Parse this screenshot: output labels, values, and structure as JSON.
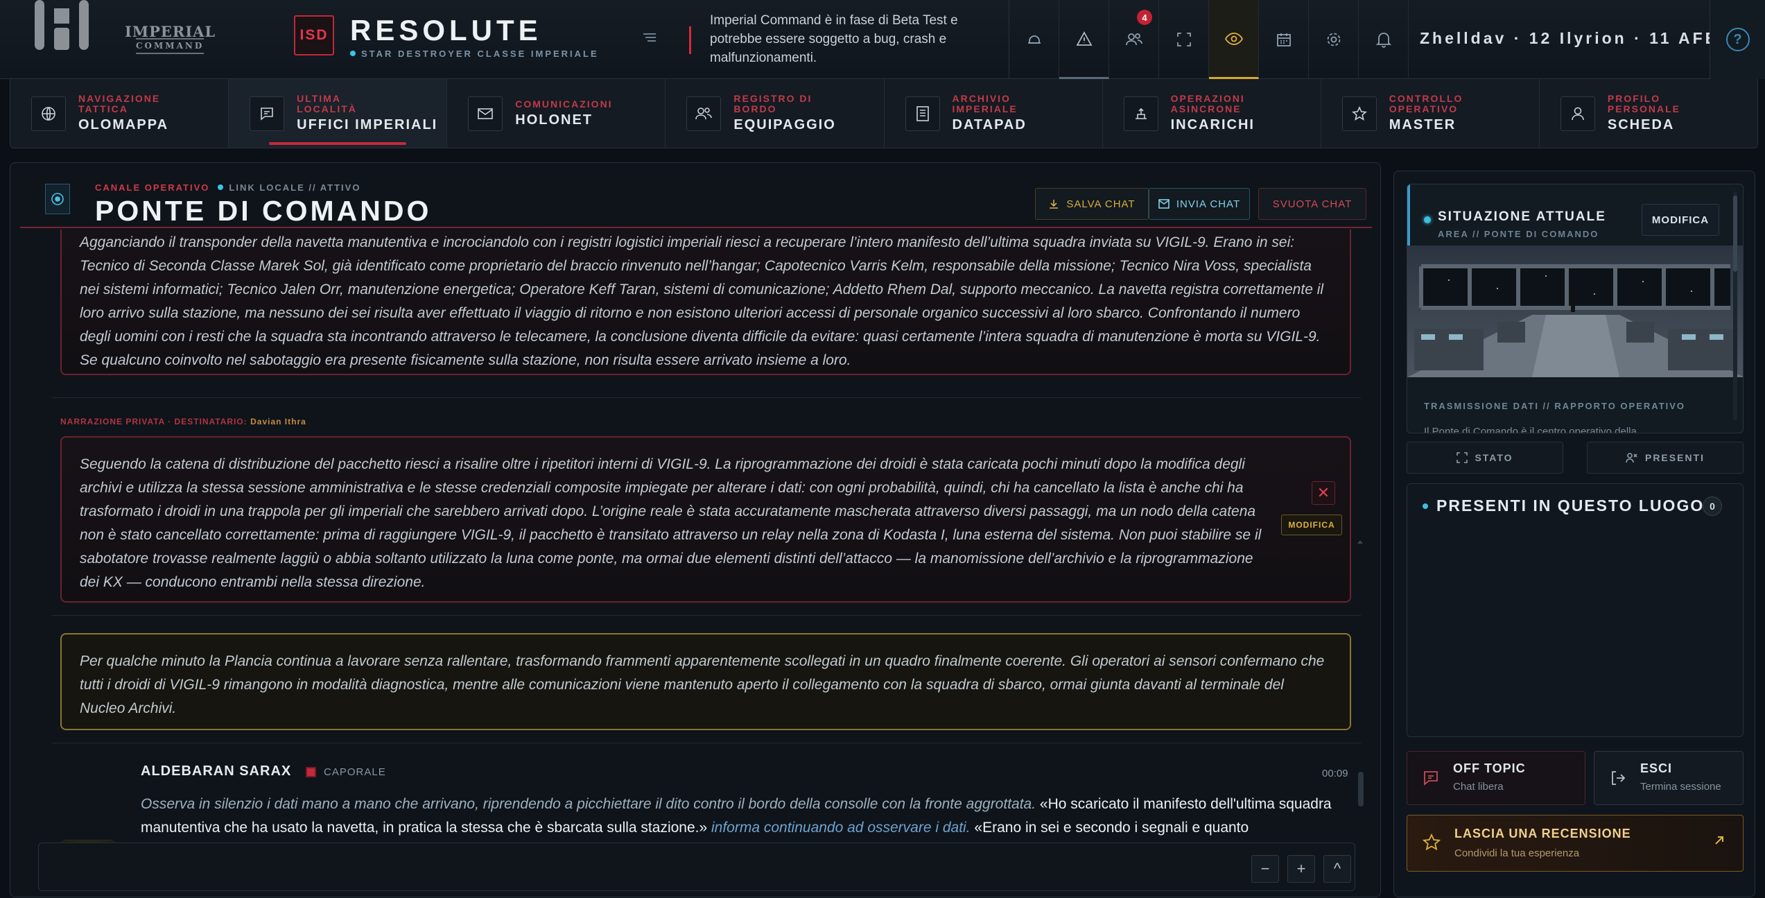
{
  "brand": {
    "emblem_line1": "IMPERIAL",
    "emblem_line2": "COMMAND"
  },
  "ship": {
    "badge": "ISD",
    "name": "RESOLUTE",
    "class": "STAR DESTROYER CLASSE IMPERIALE"
  },
  "beta_notice": "Imperial Command è in fase di Beta Test e potrebbe essere soggetto a bug, crash e malfunzionamenti.",
  "toolbar": {
    "notification_badge": "4",
    "date": "Zhelldav · 12 Ilyrion · 11 AFE",
    "help": "?"
  },
  "nav": [
    {
      "category": "NAVIGAZIONE TATTICA",
      "label": "OLOMAPPA",
      "icon": "globe-icon"
    },
    {
      "category": "ULTIMA LOCALITÀ",
      "label": "UFFICI IMPERIALI",
      "icon": "chat-icon",
      "active": true
    },
    {
      "category": "COMUNICAZIONI",
      "label": "HOLONET",
      "icon": "mail-icon"
    },
    {
      "category": "REGISTRO DI BORDO",
      "label": "EQUIPAGGIO",
      "icon": "users-icon"
    },
    {
      "category": "ARCHIVIO IMPERIALE",
      "label": "DATAPAD",
      "icon": "document-icon"
    },
    {
      "category": "OPERAZIONI ASINCRONE",
      "label": "INCARICHI",
      "icon": "tasks-icon"
    },
    {
      "category": "CONTROLLO OPERATIVO",
      "label": "MASTER",
      "icon": "star-icon"
    },
    {
      "category": "PROFILO PERSONALE",
      "label": "SCHEDA",
      "icon": "user-icon"
    }
  ],
  "channel": {
    "type": "CANALE OPERATIVO",
    "status": "LINK LOCALE // ATTIVO",
    "title": "PONTE DI COMANDO",
    "save_label": "SALVA CHAT",
    "send_label": "INVIA CHAT",
    "clear_label": "SVUOTA CHAT"
  },
  "messages": {
    "narr1": "Agganciando il transponder della navetta manutentiva e incrociandolo con i registri logistici imperiali riesci a recuperare l’intero manifesto dell’ultima squadra inviata su VIGIL-9. Erano in sei: Tecnico di Seconda Classe Marek Sol, già identificato come proprietario del braccio rinvenuto nell’hangar; Capotecnico Varris Kelm, responsabile della missione; Tecnico Nira Voss, specialista nei sistemi informatici; Tecnico Jalen Orr, manutenzione energetica; Operatore Keff Taran, sistemi di comunicazione; Addetto Rhem Dal, supporto meccanico. La navetta registra correttamente il loro arrivo sulla stazione, ma nessuno dei sei risulta aver effettuato il viaggio di ritorno e non esistono ulteriori accessi di personale organico successivi al loro sbarco. Confrontando il numero degli uomini con i resti che la squadra sta incontrando attraverso le telecamere, la conclusione diventa difficile da evitare: quasi certamente l’intera squadra di manutenzione è morta su VIGIL-9. Se qualcuno coinvolto nel sabotaggio era presente fisicamente sulla stazione, non risulta essere arrivato insieme a loro.",
    "private_label": "NARRAZIONE PRIVATA · DESTINATARIO:",
    "private_recipient": "Davian Ithra",
    "narr2": "Seguendo la catena di distribuzione del pacchetto riesci a risalire oltre i ripetitori interni di VIGIL-9. La riprogrammazione dei droidi è stata caricata pochi minuti dopo la modifica degli archivi e utilizza la stessa sessione amministrativa e le stesse credenziali composite impiegate per alterare i dati: con ogni probabilità, quindi, chi ha cancellato la lista è anche chi ha trasformato i droidi in una trappola per gli imperiali che sarebbero arrivati dopo. L’origine reale è stata accuratamente mascherata attraverso diversi passaggi, ma un nodo della catena non è stato cancellato correttamente: prima di raggiungere VIGIL-9, il pacchetto è transitato attraverso un relay nella zona di Kodasta I, luna esterna del sistema. Non puoi stabilire se il sabotatore trovasse realmente laggiù o abbia soltanto utilizzato la luna come ponte, ma ormai due elementi distinti dell’attacco — la manomissione dell’archivio e la riprogrammazione dei KX — conducono entrambi nella stessa direzione.",
    "close": "✕",
    "edit": "MODIFICA",
    "narr3": "Per qualche minuto la Plancia continua a lavorare senza rallentare, trasformando frammenti apparentemente scollegati in un quadro finalmente coerente. Gli operatori ai sensori confermano che tutti i droidi di VIGIL-9 rimangono in modalità diagnostica, mentre alle comunicazioni viene mantenuto aperto il collegamento con la squadra di sbarco, ormai giunta davanti al terminale del Nucleo Archivi.",
    "chat": {
      "name": "ALDEBARAN SARAX",
      "rank": "CAPORALE",
      "time": "00:09",
      "action1": "Osserva in silenzio i dati mano a mano che arrivano, riprendendo a picchiettare il dito contro il bordo della consolle con la fronte aggrottata.",
      "speech1": "«Ho scaricato il manifesto dell'ultima squadra manutentiva che ha usato la navetta, in pratica la stessa che è sbarcata sulla stazione.»",
      "action2": "informa continuando ad osservare i dati.",
      "speech2": "«Erano in sei e secondo i segnali e quanto"
    }
  },
  "input": {
    "minus": "−",
    "plus": "+",
    "up": "^"
  },
  "side": {
    "situation": {
      "title": "SITUAZIONE ATTUALE",
      "area": "AREA // PONTE DI COMANDO",
      "edit": "MODIFICA",
      "subtitle": "TRASMISSIONE DATI // RAPPORTO OPERATIVO",
      "desc": "Il Ponte di Comando è il centro operativo della"
    },
    "tabs": {
      "status": "STATO",
      "present": "PRESENTI"
    },
    "present": {
      "title": "PRESENTI IN QUESTO LUOGO",
      "count": "0"
    },
    "offtopic": {
      "title": "OFF TOPIC",
      "sub": "Chat libera"
    },
    "exit": {
      "title": "ESCI",
      "sub": "Termina sessione"
    },
    "review": {
      "title": "LASCIA UNA RECENSIONE",
      "sub": "Condividi la tua esperienza"
    }
  },
  "colors": {
    "accent_red": "#c42a3b",
    "accent_gold": "#d9a72e",
    "accent_cyan": "#38c5e8"
  }
}
